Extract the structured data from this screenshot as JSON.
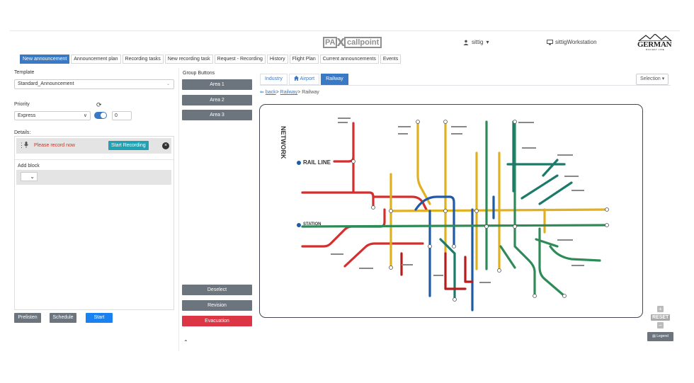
{
  "header": {
    "logo_pa": "PA",
    "logo_x": "X",
    "logo_callpoint": "callpoint",
    "user_icon": "user-icon",
    "user_name": "sittig",
    "user_caret": "▾",
    "workstation_icon": "monitor-icon",
    "workstation": "sittigWorkstation",
    "brand_name": "GERMAN",
    "brand_sub": "RAILWAY LINE"
  },
  "tabs": [
    {
      "label": "New announcement",
      "active": true
    },
    {
      "label": "Announcement plan"
    },
    {
      "label": "Recording tasks"
    },
    {
      "label": "New recording task"
    },
    {
      "label": "Request - Recording"
    },
    {
      "label": "History"
    },
    {
      "label": "Flight Plan"
    },
    {
      "label": "Current announcements"
    },
    {
      "label": "Events"
    }
  ],
  "left": {
    "template_label": "Template",
    "template_value": "Standard_Announcement",
    "priority_label": "Priority",
    "priority_value": "Express",
    "priority_number": "0",
    "details_label": "Details:",
    "record_msg": "Please record now",
    "start_recording": "Start Recording",
    "add_block_label": "Add block",
    "prelisten": "Prelisten",
    "schedule": "Schedule",
    "start": "Start"
  },
  "groups": {
    "label": "Group Buttons",
    "areas": [
      "Area 1",
      "Area 2",
      "Area 3"
    ],
    "deselect": "Deselect",
    "revision": "Revision",
    "evacuation": "Evacuation",
    "collapse_icon": "double-chevron-up-icon"
  },
  "map": {
    "tabs": [
      {
        "label": "Industry"
      },
      {
        "label": "Airport",
        "icon": "home-icon"
      },
      {
        "label": "Railway",
        "active": true
      }
    ],
    "selection": "Selection",
    "crumb_back": "back",
    "crumb_sep1": ">",
    "crumb_railway": "Railway",
    "crumb_sep2": ">",
    "crumb_current": "Railway",
    "title_network": "NETWORK",
    "title_rail_line": "RAIL LINE",
    "title_station": "STATION",
    "line_colors": {
      "red": "#d32f2f",
      "yellow": "#e0b020",
      "blue": "#1e5aa8",
      "green": "#2e8b57",
      "teal": "#1b7a6a",
      "darkred": "#b71c1c"
    }
  },
  "zoom": {
    "plus": "+",
    "reset": "RESET",
    "minus": "−",
    "legend": "Legend"
  }
}
